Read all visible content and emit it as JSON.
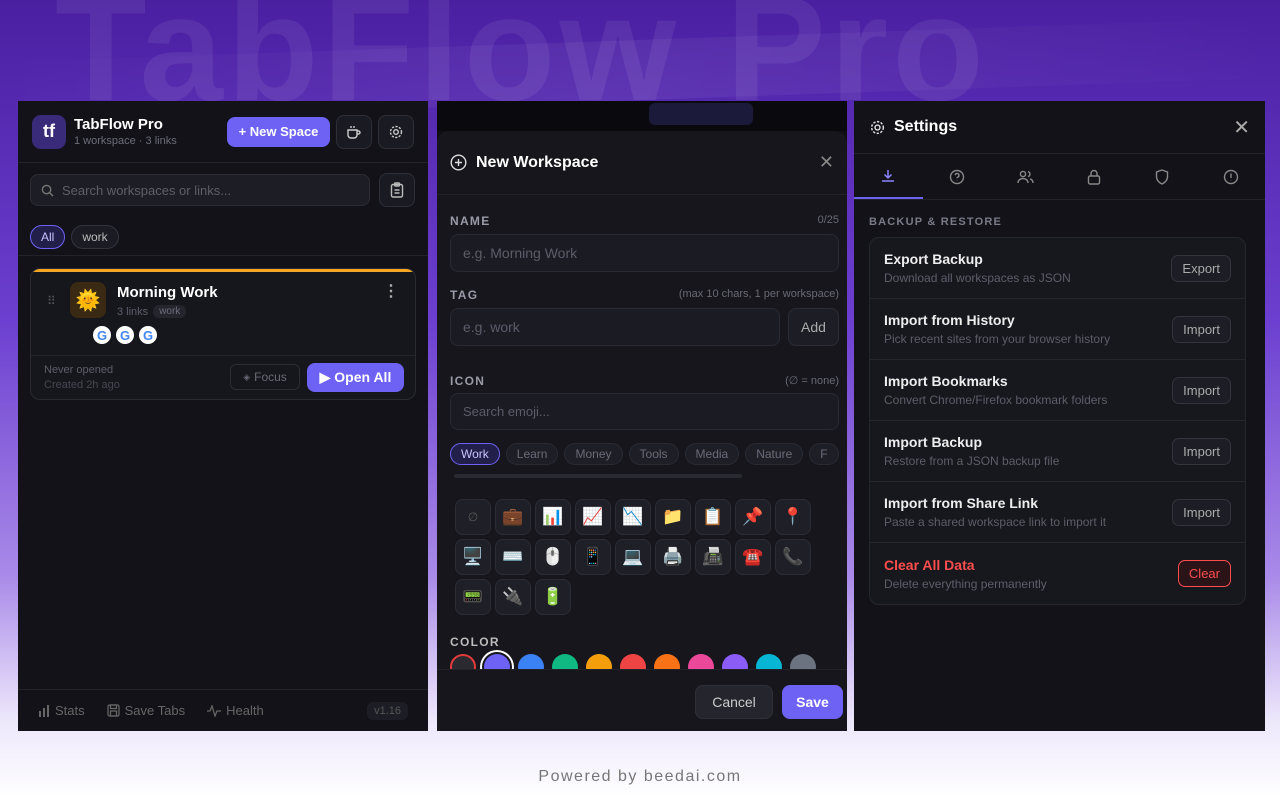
{
  "background": {
    "title": "TabFlow Pro"
  },
  "footer": {
    "text": "Powered by beedai.com"
  },
  "colors": {
    "accent": "#6e62f5",
    "danger": "#ff4d4d",
    "focus_bar": "#f5a623"
  },
  "panel1": {
    "app_title": "TabFlow Pro",
    "app_subtitle": "1 workspace · 3 links",
    "logo_text": "tf",
    "new_space_label": "+ New Space",
    "search_placeholder": "Search workspaces or links...",
    "filters": [
      "All",
      "work"
    ],
    "workspace": {
      "name": "Morning Work",
      "links": "3 links",
      "tag": "work",
      "icon": "🌞",
      "favicons": [
        "G",
        "G",
        "G"
      ],
      "last_opened": "Never opened",
      "created": "Created 2h ago",
      "focus_label": "Focus",
      "open_all_label": "▶ Open All"
    },
    "bottom": {
      "stats": "Stats",
      "save_tabs": "Save Tabs",
      "health": "Health",
      "version": "v1.16"
    }
  },
  "panel2": {
    "title": "New Workspace",
    "name_label": "NAME",
    "name_count": "0/25",
    "name_placeholder": "e.g. Morning Work",
    "tag_label": "TAG",
    "tag_hint": "(max 10 chars, 1 per workspace)",
    "tag_placeholder": "e.g. work",
    "add_label": "Add",
    "icon_label": "ICON",
    "icon_hint": "(∅ = none)",
    "emoji_search_placeholder": "Search emoji...",
    "categories": [
      "Work",
      "Learn",
      "Money",
      "Tools",
      "Media",
      "Nature",
      "F"
    ],
    "emojis": [
      "∅",
      "💼",
      "📊",
      "📈",
      "📉",
      "📁",
      "📋",
      "📌",
      "📍",
      "🖥️",
      "⌨️",
      "🖱️",
      "📱",
      "💻",
      "🖨️",
      "📠",
      "☎️",
      "📞",
      "📟",
      "🔌",
      "🔋"
    ],
    "color_label": "COLOR",
    "swatches": [
      "#e23b3b",
      "#6e62f5",
      "#3b82f6",
      "#10b981",
      "#f59e0b",
      "#ef4444",
      "#f97316",
      "#ec4899",
      "#8b5cf6",
      "#06b6d4",
      "#6b7280"
    ],
    "cancel_label": "Cancel",
    "save_label": "Save"
  },
  "panel3": {
    "title": "Settings",
    "section": "BACKUP & RESTORE",
    "rows": [
      {
        "title": "Export Backup",
        "sub": "Download all workspaces as JSON",
        "action": "Export"
      },
      {
        "title": "Import from History",
        "sub": "Pick recent sites from your browser history",
        "action": "Import"
      },
      {
        "title": "Import Bookmarks",
        "sub": "Convert Chrome/Firefox bookmark folders",
        "action": "Import"
      },
      {
        "title": "Import Backup",
        "sub": "Restore from a JSON backup file",
        "action": "Import"
      },
      {
        "title": "Import from Share Link",
        "sub": "Paste a shared workspace link to import it",
        "action": "Import"
      },
      {
        "title": "Clear All Data",
        "sub": "Delete everything permanently",
        "action": "Clear"
      }
    ]
  }
}
